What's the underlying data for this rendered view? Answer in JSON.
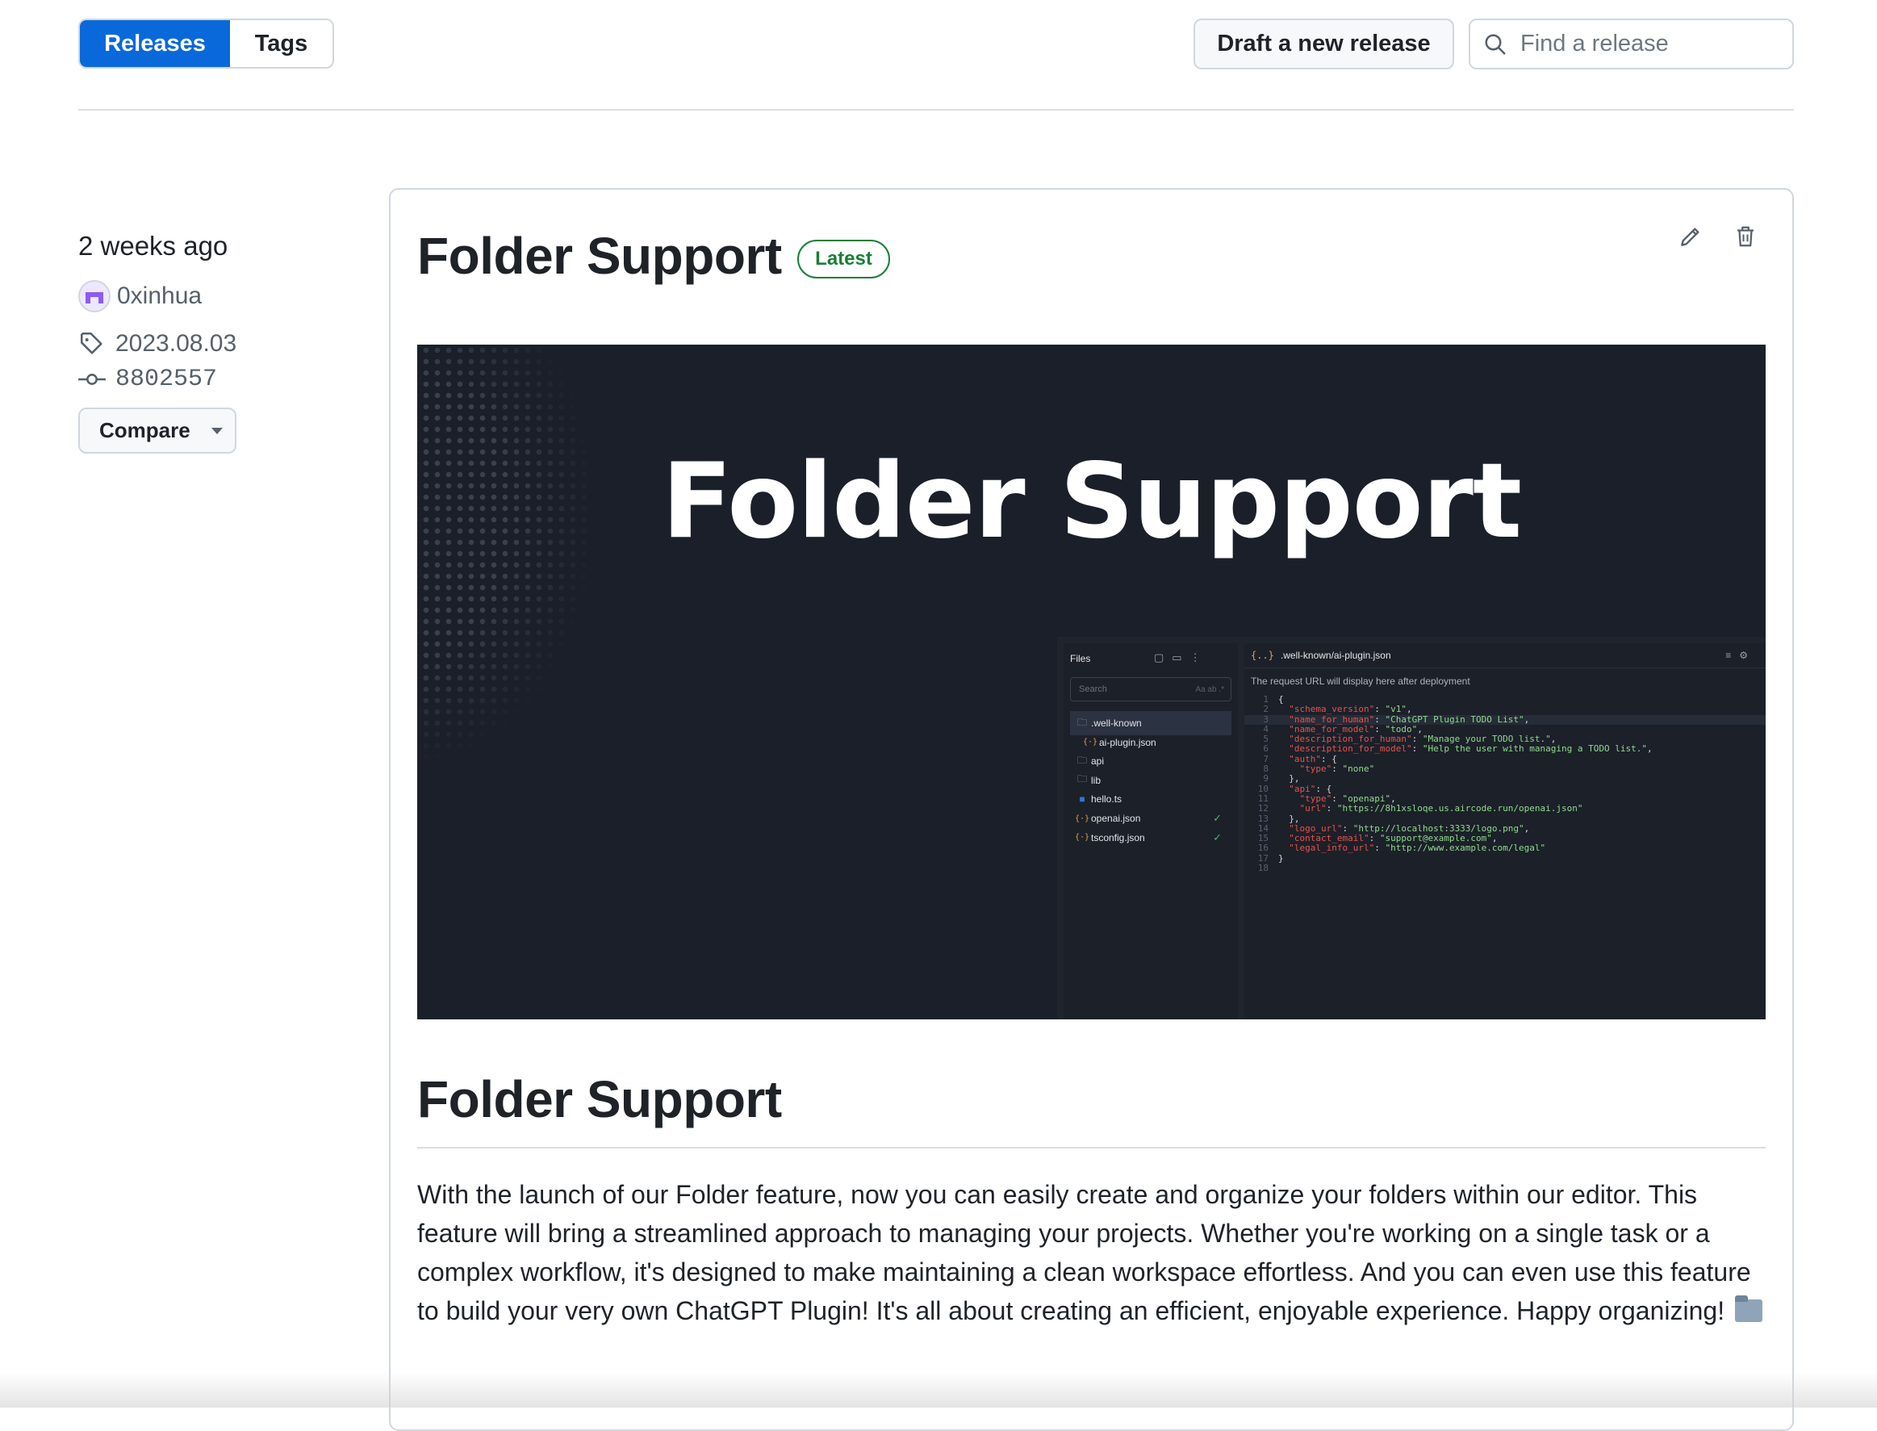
{
  "nav": {
    "tabs": [
      {
        "label": "Releases",
        "active": true
      },
      {
        "label": "Tags",
        "active": false
      }
    ],
    "draft_button": "Draft a new release",
    "search": {
      "placeholder": "Find a release",
      "value": ""
    }
  },
  "release": {
    "time_ago": "2 weeks ago",
    "author": "0xinhua",
    "tag": "2023.08.03",
    "commit": "8802557",
    "compare_label": "Compare",
    "title": "Folder Support",
    "badge": "Latest",
    "banner": {
      "title": "Folder Support",
      "files_header": "Files",
      "search_placeholder": "Search",
      "search_options": "Aa  ab  .*",
      "files": [
        {
          "name": ".well-known",
          "type": "folder",
          "selected": true
        },
        {
          "name": "ai-plugin.json",
          "type": "json",
          "indent": true
        },
        {
          "name": "api",
          "type": "folder"
        },
        {
          "name": "lib",
          "type": "folder"
        },
        {
          "name": "hello.ts",
          "type": "ts"
        },
        {
          "name": "openai.json",
          "type": "json",
          "check": true
        },
        {
          "name": "tsconfig.json",
          "type": "json",
          "check": true
        }
      ],
      "editor_tab": ".well-known/ai-plugin.json",
      "url_note": "The request URL will display here after deployment",
      "code": [
        {
          "n": "1",
          "t": "{"
        },
        {
          "n": "2",
          "k": "  \"schema_version\"",
          "v": "\"v1\"",
          "e": ","
        },
        {
          "n": "3",
          "k": "  \"name_for_human\"",
          "v": "\"ChatGPT Plugin TODO List\"",
          "e": ",",
          "hl": true
        },
        {
          "n": "4",
          "k": "  \"name_for_model\"",
          "v": "\"todo\"",
          "e": ","
        },
        {
          "n": "5",
          "k": "  \"description_for_human\"",
          "v": "\"Manage your TODO list.\"",
          "e": ","
        },
        {
          "n": "6",
          "k": "  \"description_for_model\"",
          "v": "\"Help the user with managing a TODO list.\"",
          "e": ","
        },
        {
          "n": "7",
          "k": "  \"auth\"",
          "t2": ": {"
        },
        {
          "n": "8",
          "k": "    \"type\"",
          "v": "\"none\""
        },
        {
          "n": "9",
          "t": "  },"
        },
        {
          "n": "10",
          "k": "  \"api\"",
          "t2": ": {"
        },
        {
          "n": "11",
          "k": "    \"type\"",
          "v": "\"openapi\"",
          "e": ","
        },
        {
          "n": "12",
          "k": "    \"url\"",
          "v": "\"https://8h1xsloqe.us.aircode.run/openai.json\""
        },
        {
          "n": "13",
          "t": "  },"
        },
        {
          "n": "14",
          "k": "  \"logo_url\"",
          "v": "\"http://localhost:3333/logo.png\"",
          "e": ","
        },
        {
          "n": "15",
          "k": "  \"contact_email\"",
          "v": "\"support@example.com\"",
          "e": ","
        },
        {
          "n": "16",
          "k": "  \"legal_info_url\"",
          "v": "\"http://www.example.com/legal\""
        },
        {
          "n": "17",
          "t": "}"
        },
        {
          "n": "18",
          "t": ""
        }
      ]
    },
    "body_heading": "Folder Support",
    "body_text": "With the launch of our Folder feature, now you can easily create and organize your folders within our editor. This feature will bring a streamlined approach to managing your projects. Whether you're working on a single task or a complex workflow, it's designed to make maintaining a clean workspace effortless. And you can even use this feature to build your very own ChatGPT Plugin! It's all about creating an efficient, enjoyable experience. Happy organizing!"
  },
  "colors": {
    "primary": "#0969da",
    "latest": "#1a7f37",
    "banner_bg": "#1b1f29"
  }
}
